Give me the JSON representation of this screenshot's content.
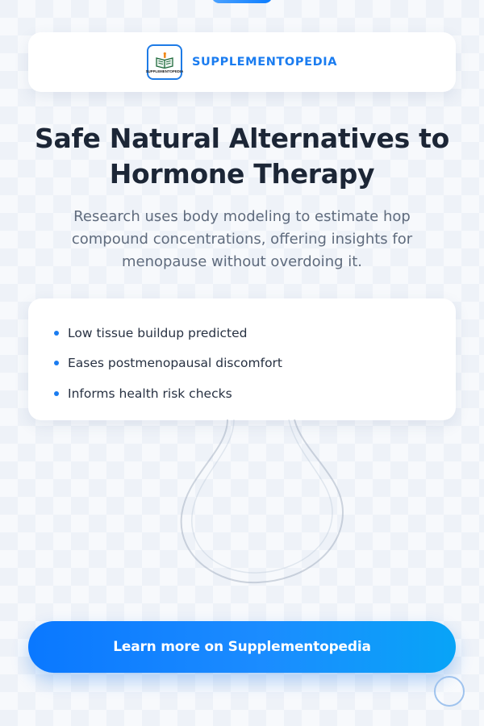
{
  "brand": {
    "name": "SUPPLEMENTOPEDIA",
    "logo_text": "SUPPLEMENTOPEDIA",
    "logo_icon": "open-book-icon"
  },
  "hero": {
    "title": "Safe Natural Alternatives to Hormone Therapy",
    "subtitle": "Research uses body modeling to estimate hop compound concentrations, offering insights for menopause without overdoing it."
  },
  "highlights": [
    "Low tissue buildup predicted",
    "Eases postmenopausal discomfort",
    "Informs health risk checks"
  ],
  "cta": {
    "label": "Learn more on Supplementopedia"
  },
  "colors": {
    "accent": "#1a7cf0",
    "headline": "#1c2636",
    "subtext": "#5f6b7d",
    "button_start": "#0a78ff",
    "button_end": "#08a4f7"
  }
}
